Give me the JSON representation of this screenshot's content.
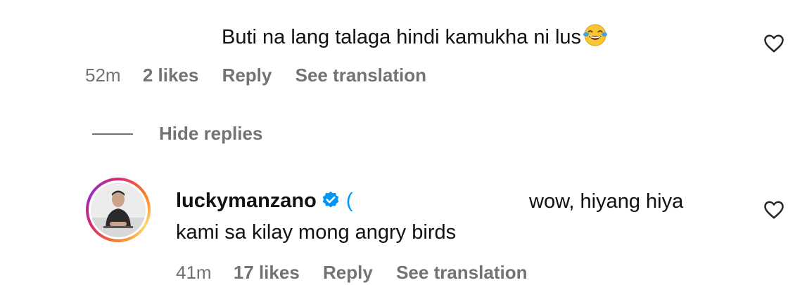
{
  "comment1": {
    "text": "Buti na lang talaga hindi kamukha ni lus",
    "emoji": "face-with-tears-of-joy",
    "time": "52m",
    "likes": "2 likes",
    "reply_label": "Reply",
    "translation_label": "See translation"
  },
  "replies_toggle": {
    "label": "Hide replies"
  },
  "reply1": {
    "username": "luckymanzano",
    "verified": true,
    "mention_fragment": "(",
    "text_line1": "wow, hiyang hiya",
    "text_line2": "kami sa kilay mong angry birds",
    "time": "41m",
    "likes": "17 likes",
    "reply_label": "Reply",
    "translation_label": "See translation"
  },
  "colors": {
    "meta_gray": "#737373",
    "verified_blue": "#0095f6",
    "text": "#111111"
  }
}
